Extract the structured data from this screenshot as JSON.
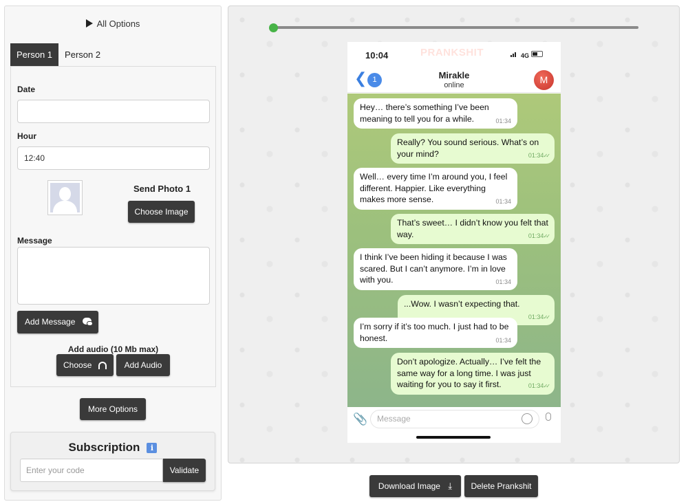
{
  "left": {
    "all_options": "All Options",
    "tabs": [
      {
        "label": "Person 1"
      },
      {
        "label": "Person 2"
      }
    ],
    "date": {
      "label": "Date",
      "value": ""
    },
    "hour": {
      "label": "Hour",
      "value": "12:40"
    },
    "send_photo": "Send Photo 1",
    "choose_image": "Choose Image",
    "message": {
      "label": "Message",
      "value": ""
    },
    "add_message": "Add Message",
    "add_audio_title": "Add audio (10 Mb max)",
    "choose": "Choose",
    "add_audio": "Add Audio",
    "more_options": "More Options",
    "subscription": {
      "title": "Subscription",
      "placeholder": "Enter your code",
      "validate": "Validate"
    }
  },
  "preview": {
    "phone": {
      "time": "10:04",
      "watermark": "PRANKSHIT",
      "network": "4G",
      "back_count": "1",
      "contact": "Mirakle",
      "status": "online",
      "avatar_letter": "M",
      "composer_placeholder": "Message"
    },
    "messages": [
      {
        "dir": "in",
        "text": "Hey… there’s something I’ve been meaning to tell you for a while.",
        "time": "01:34"
      },
      {
        "dir": "out",
        "text": "Really? You sound serious. What’s on your mind?",
        "time": "01:34"
      },
      {
        "dir": "in",
        "text": "Well… every time I’m around you, I feel different. Happier. Like everything makes more sense.",
        "time": "01:34"
      },
      {
        "dir": "out",
        "text": "That’s sweet… I didn’t know you felt that way.",
        "time": "01:34"
      },
      {
        "dir": "in",
        "text": "I think I’ve been hiding it because I was scared. But I can’t anymore. I’m in love with you.",
        "time": "01:34"
      },
      {
        "dir": "out",
        "text": "...Wow. I wasn’t expecting that.",
        "time": "01:34"
      },
      {
        "dir": "in",
        "text": "I’m sorry if it’s too much. I just had to be honest.",
        "time": "01:34"
      },
      {
        "dir": "out",
        "text": "Don’t apologize. Actually… I’ve felt the same way for a long time. I was just waiting for you to say it first.",
        "time": "01:34"
      }
    ]
  },
  "actions": {
    "download": "Download Image",
    "delete": "Delete Prankshit"
  },
  "colors": {
    "button_dark": "#3a3a3a",
    "slider_knob": "#47b347",
    "incoming": "#ffffff",
    "outgoing": "#e7fbd1"
  }
}
